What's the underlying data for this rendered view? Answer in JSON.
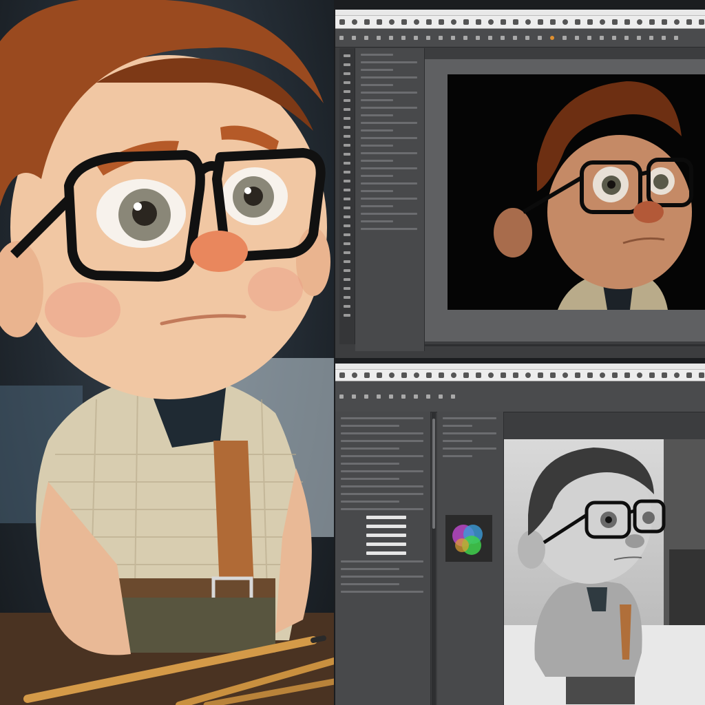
{
  "colors": {
    "hair": "#9a4a1f",
    "skin": "#f1c7a3",
    "nose": "#e9875d",
    "glasses": "#111111",
    "shirt": "#d8cdb0",
    "ui_dark": "#3c3d3f",
    "ui_light": "#ededed",
    "accent": "#d88a2a"
  },
  "icons": {
    "toolbar": [
      "tool-icon"
    ],
    "selected_tool": "active-tool-icon"
  }
}
